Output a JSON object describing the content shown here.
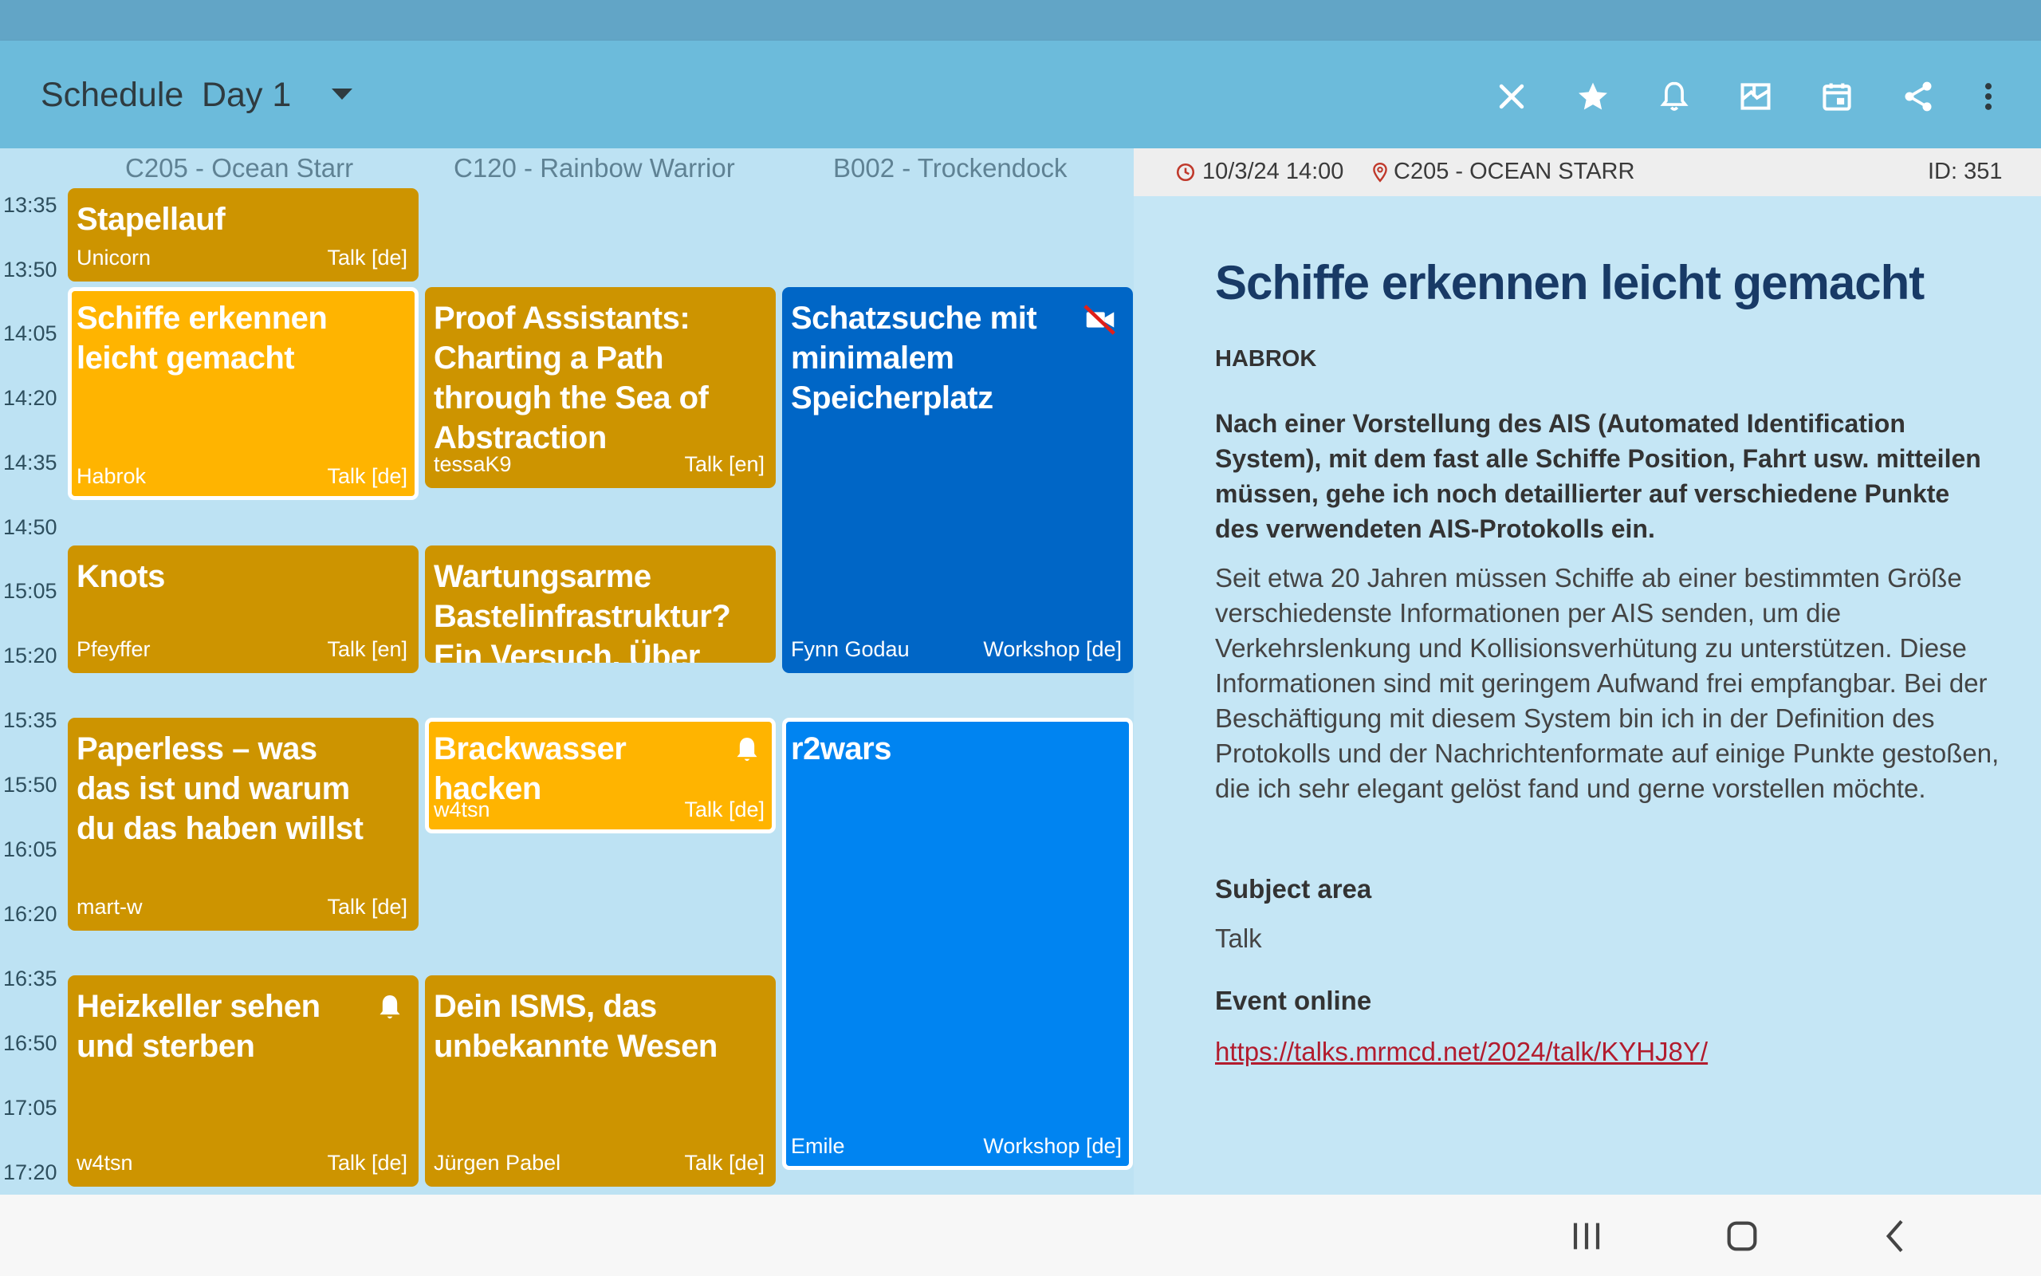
{
  "toolbar": {
    "title": "Schedule",
    "day": "Day 1",
    "icons": [
      "close-icon",
      "star-icon",
      "bell-icon",
      "map-icon",
      "calendar-icon",
      "share-icon",
      "more-vert-icon"
    ]
  },
  "rooms": [
    "C205 - Ocean Starr",
    "C120 - Rainbow Warrior",
    "B002 - Trockendock"
  ],
  "times": [
    "13:35",
    "13:50",
    "14:05",
    "14:20",
    "14:35",
    "14:50",
    "15:05",
    "15:20",
    "15:35",
    "15:50",
    "16:05",
    "16:20",
    "16:35",
    "16:50",
    "17:05",
    "17:20"
  ],
  "sessions": {
    "stapellauf": {
      "title": "Stapellauf",
      "speaker": "Unicorn",
      "type": "Talk [de]"
    },
    "schiffe": {
      "title": "Schiffe erkennen leicht gemacht",
      "speaker": "Habrok",
      "type": "Talk [de]"
    },
    "knots": {
      "title": "Knots",
      "speaker": "Pfeyffer",
      "type": "Talk [en]"
    },
    "paperless": {
      "title": "Paperless – was das ist und warum du das haben willst",
      "speaker": "mart-w",
      "type": "Talk [de]"
    },
    "heizkeller": {
      "title": "Heizkeller sehen und sterben",
      "speaker": "w4tsn",
      "type": "Talk [de]"
    },
    "proof": {
      "title": "Proof Assistants: Charting a Path through the Sea of Abstraction",
      "speaker": "tessaK9",
      "type": "Talk [en]"
    },
    "wartung": {
      "title": "Wartungsarme Bastelinfrastruktur? Ein Versuch. Über",
      "speaker": "",
      "type": ""
    },
    "brackwasser": {
      "title": "Brackwasser hacken",
      "speaker": "w4tsn",
      "type": "Talk [de]"
    },
    "isms": {
      "title": "Dein ISMS, das unbekannte Wesen",
      "speaker": "Jürgen Pabel",
      "type": "Talk [de]"
    },
    "schatzsuche": {
      "title": "Schatzsuche mit minimalem Speicherplatz",
      "speaker": "Fynn Godau",
      "type": "Workshop [de]"
    },
    "r2wars": {
      "title": "r2wars",
      "speaker": "Emile",
      "type": "Workshop [de]"
    }
  },
  "detail": {
    "datetime": "10/3/24 14:00",
    "room": "C205 - OCEAN STARR",
    "id": "ID: 351",
    "title": "Schiffe erkennen leicht gemacht",
    "speaker": "HABROK",
    "abstract": "Nach einer Vorstellung des AIS (Automated Identification System), mit dem fast alle Schiffe Position, Fahrt usw. mitteilen müssen, gehe ich noch detaillierter auf verschiedene Punkte des verwendeten AIS-Protokolls ein.",
    "description": "Seit etwa 20 Jahren müssen Schiffe ab einer bestimmten Größe verschiedenste Informationen per AIS senden, um die Verkehrslenkung und Kollisionsverhütung zu unterstützen. Diese Informationen sind mit geringem Aufwand frei empfangbar. Bei der Beschäftigung mit diesem System bin ich in der Definition des Protokolls und der Nachrichtenformate auf einige Punkte gestoßen, die ich sehr elegant gelöst fand und gerne vorstellen möchte.",
    "subject_heading": "Subject area",
    "subject_value": "Talk",
    "online_heading": "Event online",
    "link": "https://talks.mrmcd.net/2024/talk/KYHJ8Y/"
  },
  "colors": {
    "talk": "#cd9400",
    "talk_favorite": "#ffb400",
    "workshop": "#0066c6",
    "workshop_favorite": "#0084f1",
    "link": "#b21c2e"
  }
}
